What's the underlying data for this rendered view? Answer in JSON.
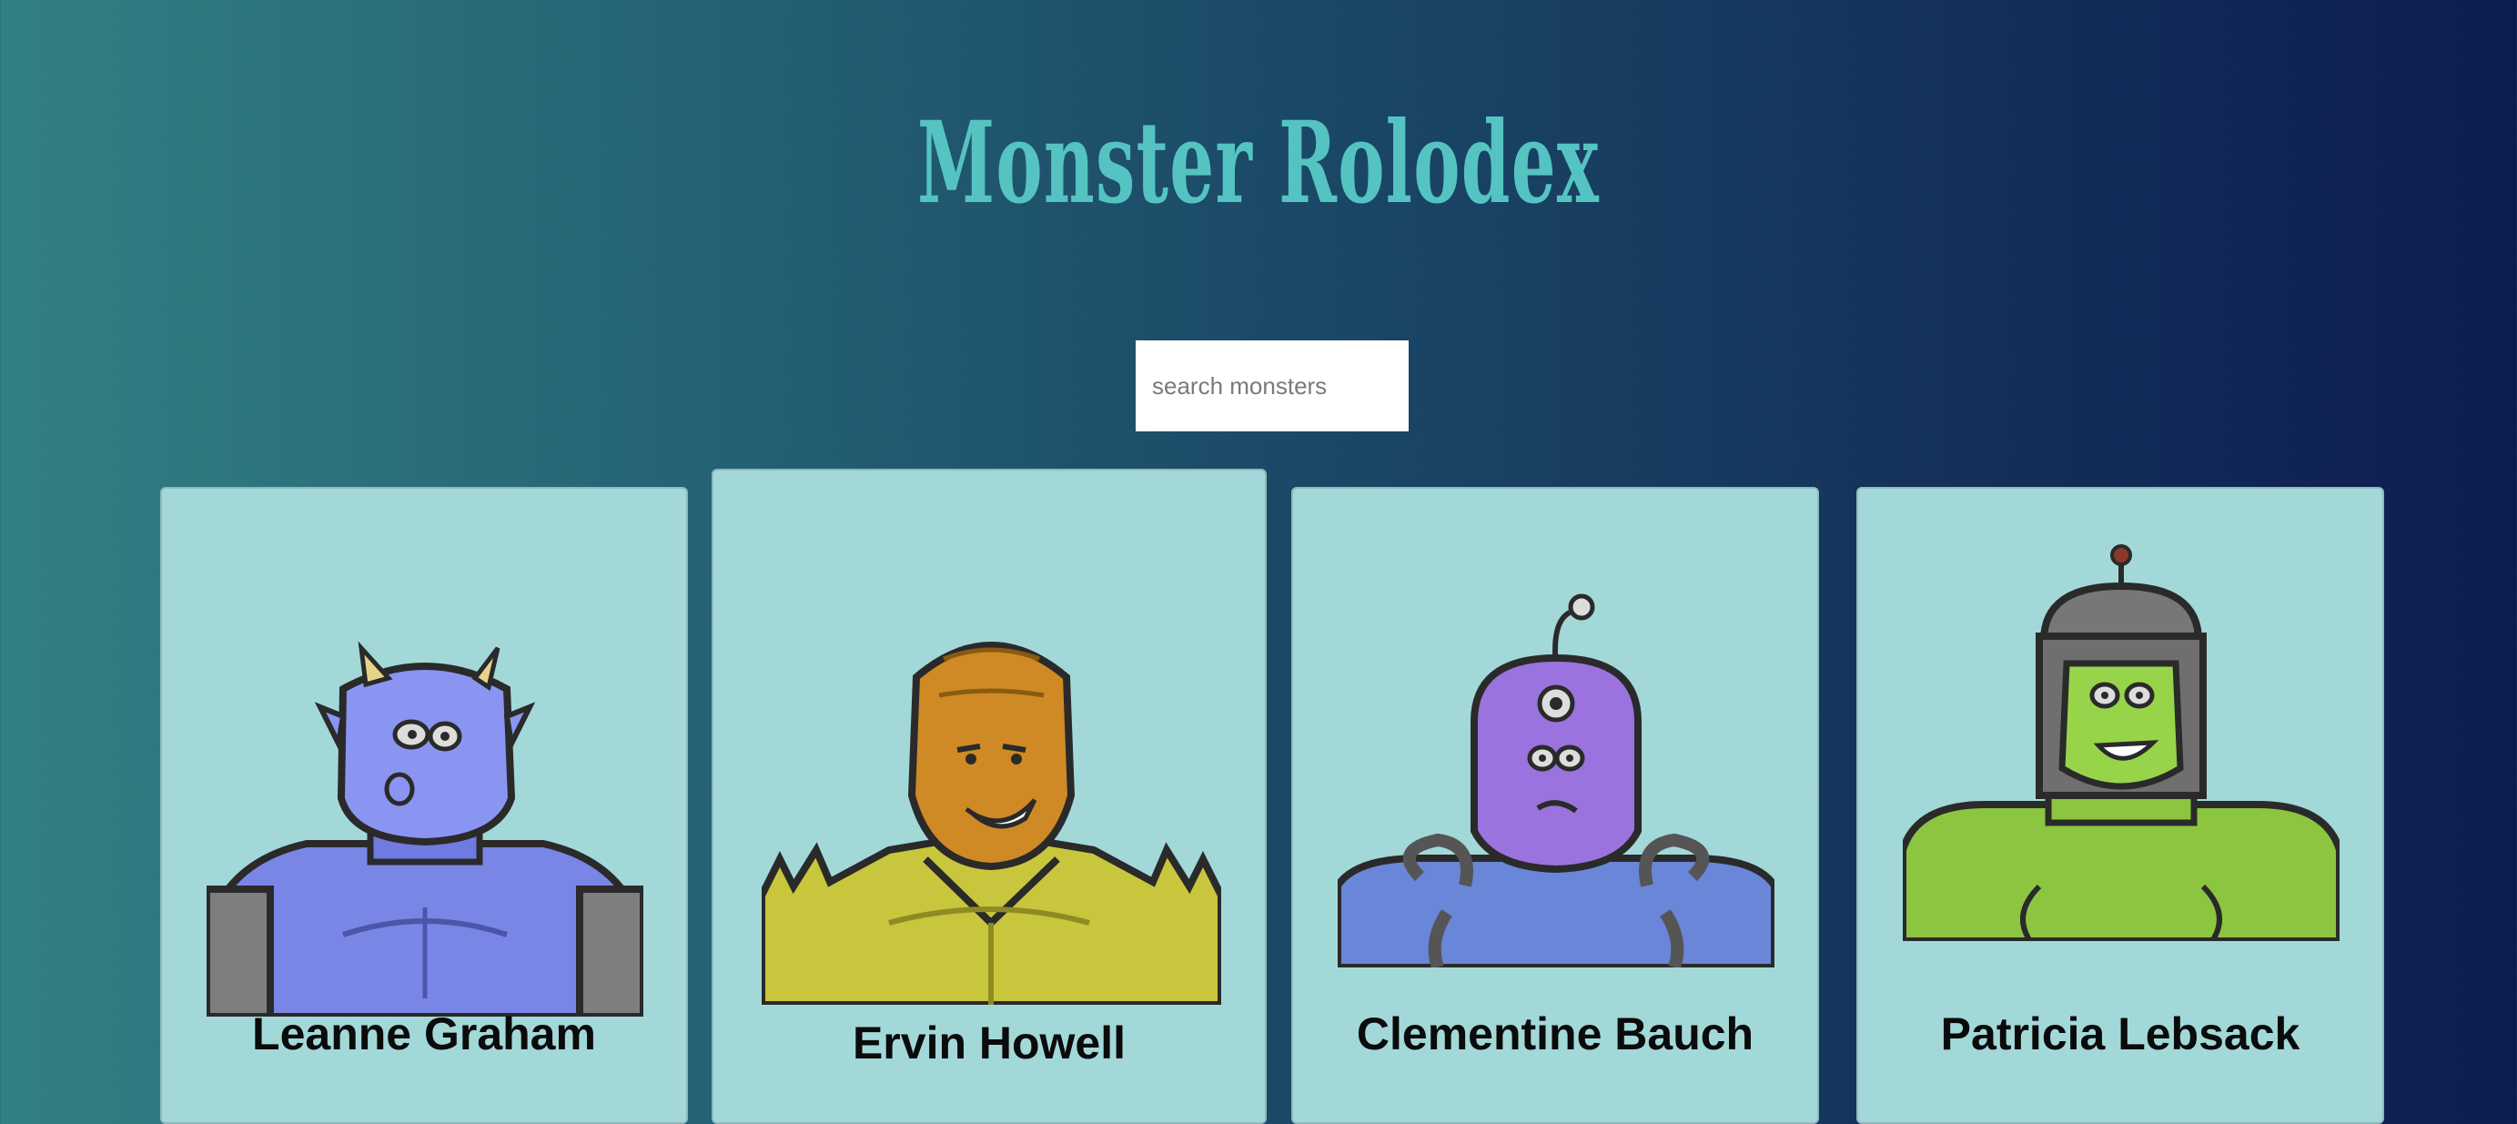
{
  "app": {
    "title": "Monster Rolodex"
  },
  "search": {
    "placeholder": "search monsters",
    "value": ""
  },
  "monsters": [
    {
      "name": "Leanne Graham",
      "avatar": "blue-horned-monster"
    },
    {
      "name": "Ervin Howell",
      "avatar": "orange-spiky-monster"
    },
    {
      "name": "Clementine Bauch",
      "avatar": "purple-cyclops-monster"
    },
    {
      "name": "Patricia Lebsack",
      "avatar": "green-helmet-monster"
    }
  ],
  "colors": {
    "title": "#55c3c2",
    "card_background": "#a3d8d9",
    "gradient_left": "#318083",
    "gradient_right": "#0d1c4f"
  }
}
